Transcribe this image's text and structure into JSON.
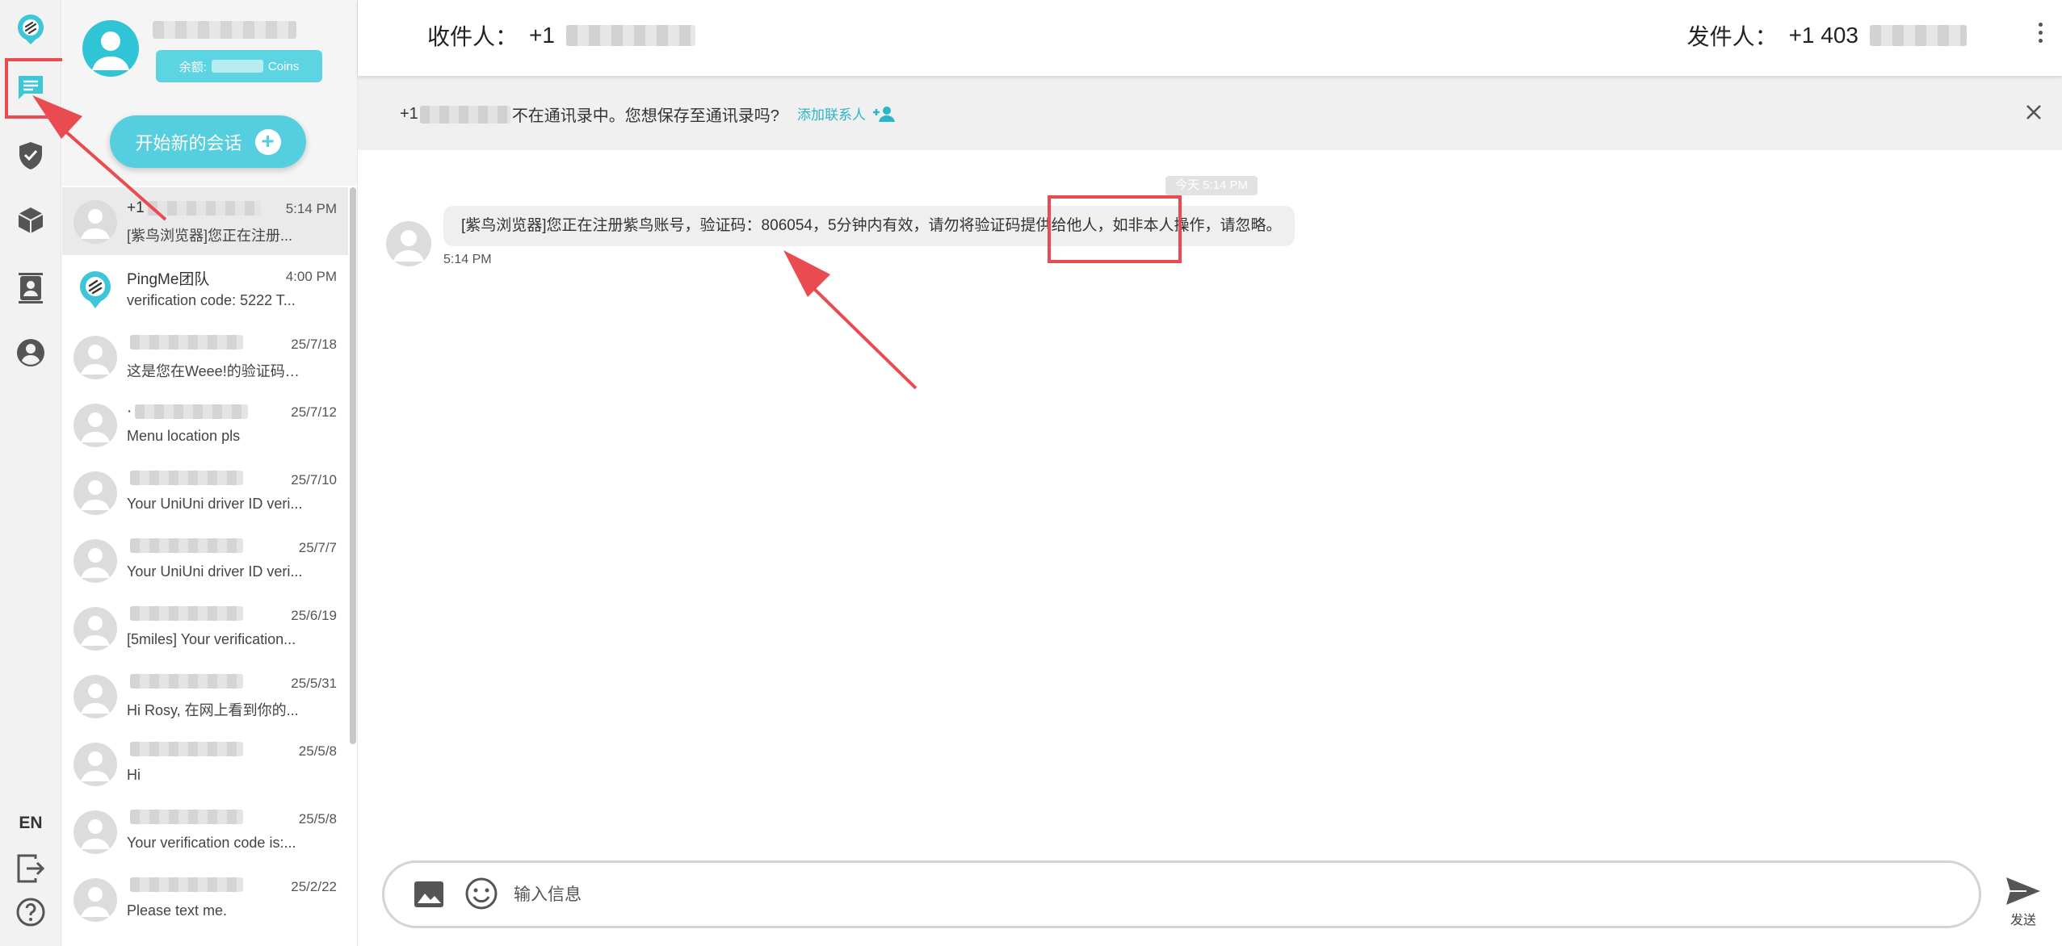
{
  "rail": {
    "language": "EN",
    "icons": [
      "pingme-logo-icon",
      "messages-icon",
      "shield-check-icon",
      "cube-icon",
      "contacts-icon",
      "account-icon",
      "logout-icon",
      "help-icon"
    ]
  },
  "profile": {
    "coins_prefix": "余额:",
    "coins_suffix": "Coins",
    "new_chat_label": "开始新的会话"
  },
  "conversations": [
    {
      "name": "+1",
      "time": "5:14 PM",
      "preview": "[紫鸟浏览器]您正在注册...",
      "active": true
    },
    {
      "name": "PingMe团队",
      "time": "4:00 PM",
      "preview": "verification code: 5222 T..."
    },
    {
      "name": "",
      "time": "25/7/18",
      "preview": "这是您在Weee!的验证码3..."
    },
    {
      "name": "·",
      "time": "25/7/12",
      "preview": "Menu location pls"
    },
    {
      "name": "",
      "time": "25/7/10",
      "preview": "Your UniUni driver ID veri..."
    },
    {
      "name": "",
      "time": "25/7/7",
      "preview": "Your UniUni driver ID veri..."
    },
    {
      "name": "",
      "time": "25/6/19",
      "preview": "[5miles] Your verification..."
    },
    {
      "name": "",
      "time": "25/5/31",
      "preview": "Hi Rosy, 在网上看到你的..."
    },
    {
      "name": "",
      "time": "25/5/8",
      "preview": "Hi"
    },
    {
      "name": "",
      "time": "25/5/8",
      "preview": "Your verification code is:..."
    },
    {
      "name": "",
      "time": "25/2/22",
      "preview": "Please text me."
    }
  ],
  "header": {
    "to_label": "收件人：",
    "to_number": "+1",
    "from_label": "发件人：",
    "from_number": "+1 403"
  },
  "notice": {
    "prefix": "+1",
    "text": "不在通讯录中。您想保存至通讯录吗?",
    "add_contact": "添加联系人"
  },
  "thread": {
    "date_chip": "今天 5:14 PM",
    "message": "[紫鸟浏览器]您正在注册紫鸟账号，验证码：806054，5分钟内有效，请勿将验证码提供给他人，如非本人操作，请忽略。",
    "time": "5:14 PM"
  },
  "composer": {
    "placeholder": "输入信息",
    "send_label": "发送"
  },
  "colors": {
    "accent": "#55cfdf",
    "annotation_red": "#e94b50"
  }
}
